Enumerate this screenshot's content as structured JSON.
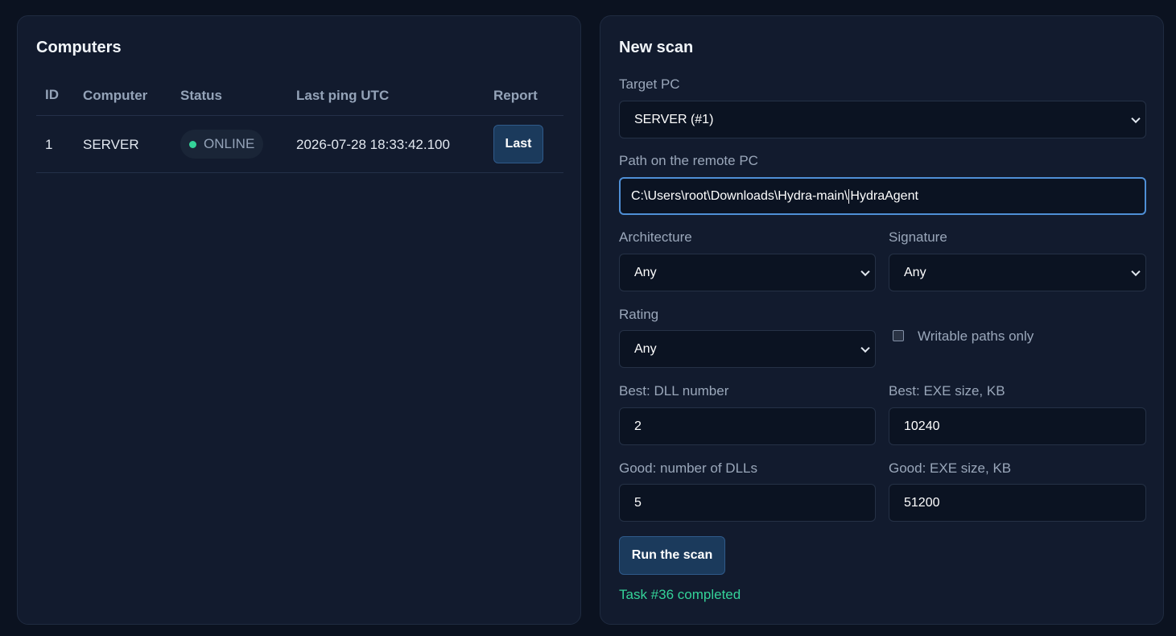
{
  "computers": {
    "title": "Computers",
    "columns": [
      "ID",
      "Computer",
      "Status",
      "Last ping UTC",
      "Report"
    ],
    "rows": [
      {
        "id": "1",
        "computer": "SERVER",
        "status": "ONLINE",
        "last_ping": "2026-07-28 18:33:42.100",
        "report_button": "Last"
      }
    ]
  },
  "scan": {
    "title": "New scan",
    "target_label": "Target PC",
    "target_value": "SERVER (#1)",
    "path_label": "Path on the remote PC",
    "path_value_before_caret": "C:\\Users\\root\\Downloads\\Hydra-main\\",
    "path_value_after_caret": "HydraAgent",
    "architecture_label": "Architecture",
    "architecture_value": "Any",
    "signature_label": "Signature",
    "signature_value": "Any",
    "rating_label": "Rating",
    "rating_value": "Any",
    "writable_label": "Writable paths only",
    "writable_checked": false,
    "best_dll_label": "Best: DLL number",
    "best_dll_value": "2",
    "best_exe_label": "Best: EXE size, KB",
    "best_exe_value": "10240",
    "good_dll_label": "Good: number of DLLs",
    "good_dll_value": "5",
    "good_exe_label": "Good: EXE size, KB",
    "good_exe_value": "51200",
    "run_button": "Run the scan",
    "task_status": "Task #36 completed"
  },
  "colors": {
    "background": "#0b1220",
    "panel": "#121b2e",
    "accent": "#1b3a5c",
    "online": "#34d399",
    "focus": "#4f8fd6"
  }
}
